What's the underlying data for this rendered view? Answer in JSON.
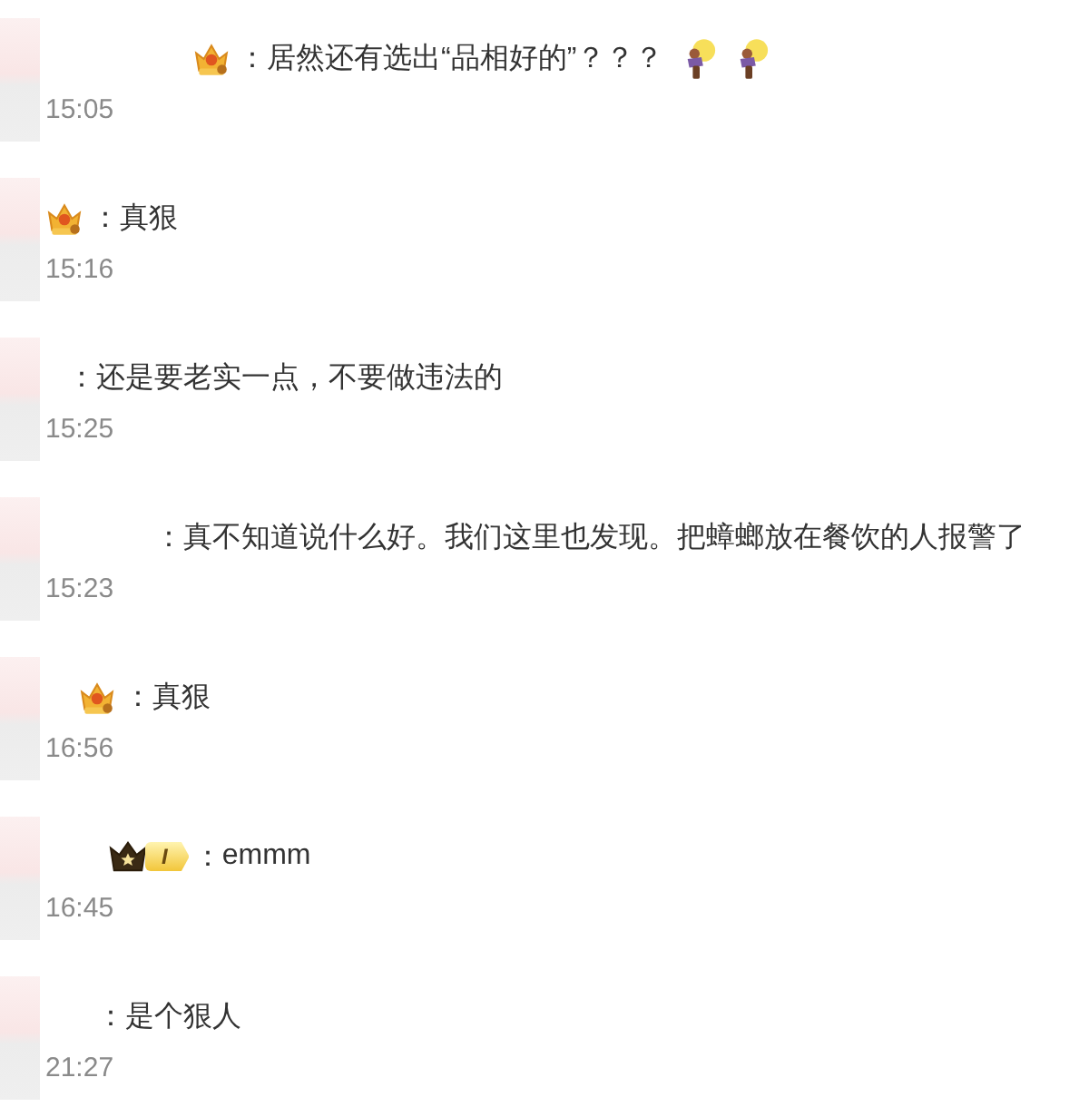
{
  "comments": [
    {
      "badge": {
        "kind": "crown"
      },
      "separator": "：",
      "text": "居然还有选出“品相好的”？？？",
      "emojis": [
        {
          "kind": "bulb"
        },
        {
          "kind": "bulb"
        }
      ],
      "time": "15:05"
    },
    {
      "badge": {
        "kind": "crown"
      },
      "separator": "：",
      "text": "真狠",
      "time": "15:16"
    },
    {
      "separator": "：",
      "text": "还是要老实一点，不要做违法的",
      "time": "15:25"
    },
    {
      "separator": "：",
      "text": "真不知道说什么好。我们这里也发现。把蟑螂放在餐饮的人报警了",
      "time": "15:23"
    },
    {
      "badge": {
        "kind": "crown"
      },
      "separator": "：",
      "text": "真狠",
      "time": "16:56"
    },
    {
      "badge": {
        "kind": "vip",
        "label": "I"
      },
      "separator": "：",
      "text": "emmm",
      "time": "16:45"
    },
    {
      "separator": "：",
      "text": "是个狠人",
      "time": "21:27"
    }
  ]
}
